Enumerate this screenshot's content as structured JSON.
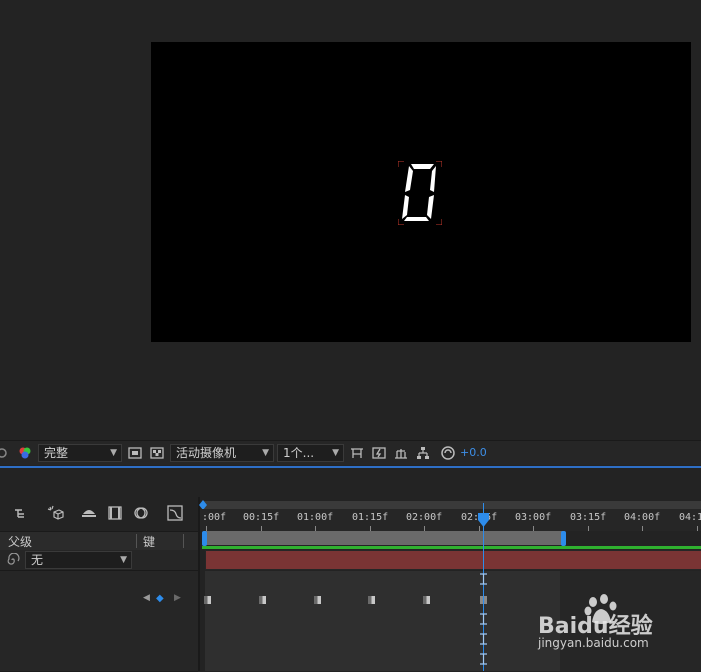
{
  "toolbar": {
    "resolution": "完整",
    "camera": "活动摄像机",
    "views": "1个...",
    "exposure": "+0.0"
  },
  "timeline": {
    "header": {
      "parent_label": "父级",
      "key_label": "键"
    },
    "parent_value": "无",
    "ruler_ticks": [
      ":00f",
      "00:15f",
      "01:00f",
      "01:15f",
      "02:00f",
      "02:15f",
      "03:00f",
      "03:15f",
      "04:00f",
      "04:1"
    ]
  },
  "comp": {
    "digit": "0"
  },
  "watermark": {
    "brand": "Baidu经验",
    "url": "jingyan.baidu.com"
  },
  "colors": {
    "accent": "#2d8ceb",
    "layer_bar": "#7a3434",
    "work_area_line": "#2fb12f"
  }
}
